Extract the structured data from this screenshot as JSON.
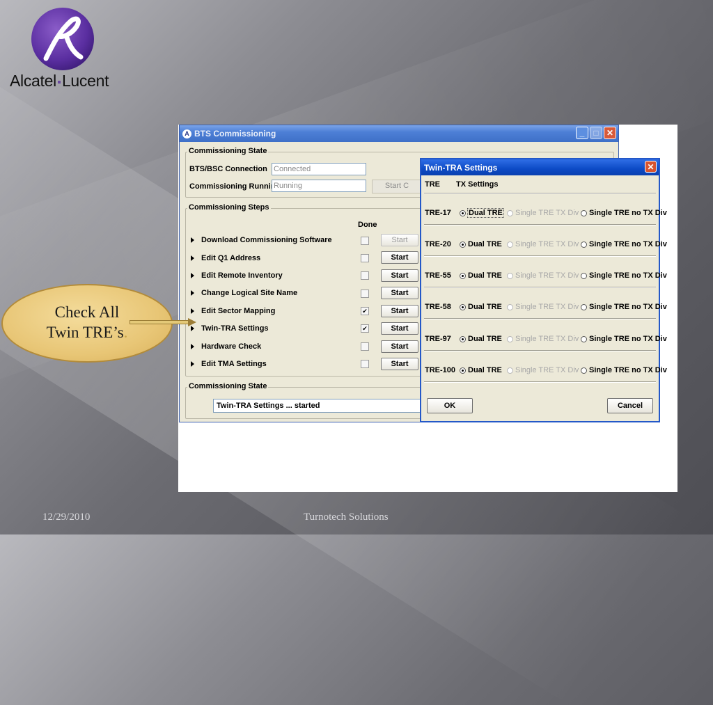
{
  "logo": {
    "text_left": "Alcatel",
    "text_right": "Lucent"
  },
  "window": {
    "title": "BTS Commissioning",
    "commissioning_state_group": "Commissioning State",
    "bts_bsc_label": "BTS/BSC Connection",
    "bts_bsc_value": "Connected",
    "running_label": "Commissioning Running",
    "running_value": "Running",
    "start_partial": "Start C",
    "steps_group": "Commissioning Steps",
    "done_header": "Done",
    "steps": [
      {
        "label": "Download Commissioning Software",
        "done": "",
        "button": "Start"
      },
      {
        "label": "Edit Q1 Address",
        "done": "",
        "button": "Start"
      },
      {
        "label": "Edit Remote Inventory",
        "done": "",
        "button": "Start"
      },
      {
        "label": "Change Logical Site Name",
        "done": "",
        "button": "Start"
      },
      {
        "label": "Edit Sector Mapping",
        "done": "✔",
        "button": "Start"
      },
      {
        "label": "Twin-TRA Settings",
        "done": "✔",
        "button": "Start"
      },
      {
        "label": "Hardware Check",
        "done": "",
        "button": "Start"
      },
      {
        "label": "Edit TMA Settings",
        "done": "",
        "button": "Start"
      }
    ],
    "status_group": "Commissioning State",
    "status_text": "Twin-TRA Settings ... started"
  },
  "dialog": {
    "title": "Twin-TRA Settings",
    "col_tre": "TRE",
    "col_tx": "TX Settings",
    "opt1": "Dual TRE",
    "opt2": "Single TRE TX Div",
    "opt3": "Single TRE no TX Div",
    "rows": [
      "TRE-17",
      "TRE-20",
      "TRE-55",
      "TRE-58",
      "TRE-97",
      "TRE-100"
    ],
    "ok": "OK",
    "cancel": "Cancel"
  },
  "callout": {
    "line1": "Check All",
    "line2": "Twin TRE’s",
    "period": "."
  },
  "footer": {
    "date": "12/29/2010",
    "company": "Turnotech Solutions"
  }
}
